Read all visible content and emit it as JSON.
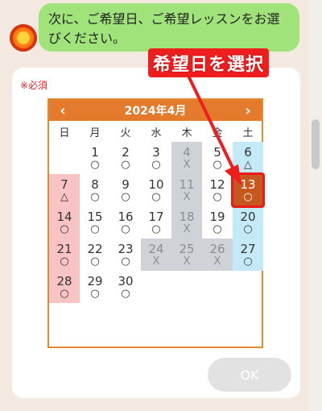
{
  "chat": {
    "message": "次に、ご希望日、ご希望レッスンをお選びください。"
  },
  "form": {
    "required_label": "※必須",
    "ok_label": "OK"
  },
  "calendar": {
    "title": "2024年4月",
    "prev": "‹",
    "next": "›",
    "weekdays": [
      "日",
      "月",
      "火",
      "水",
      "木",
      "金",
      "土"
    ],
    "days": [
      {
        "d": "",
        "m": ""
      },
      {
        "d": "1",
        "m": "○"
      },
      {
        "d": "2",
        "m": "○"
      },
      {
        "d": "3",
        "m": "○"
      },
      {
        "d": "4",
        "m": "X"
      },
      {
        "d": "5",
        "m": "○"
      },
      {
        "d": "6",
        "m": "△"
      },
      {
        "d": "7",
        "m": "△"
      },
      {
        "d": "8",
        "m": "○"
      },
      {
        "d": "9",
        "m": "○"
      },
      {
        "d": "10",
        "m": "○"
      },
      {
        "d": "11",
        "m": "X"
      },
      {
        "d": "12",
        "m": "○"
      },
      {
        "d": "13",
        "m": "○"
      },
      {
        "d": "14",
        "m": "○"
      },
      {
        "d": "15",
        "m": "○"
      },
      {
        "d": "16",
        "m": "○"
      },
      {
        "d": "17",
        "m": "○"
      },
      {
        "d": "18",
        "m": "X"
      },
      {
        "d": "19",
        "m": "○"
      },
      {
        "d": "20",
        "m": "○"
      },
      {
        "d": "21",
        "m": "○"
      },
      {
        "d": "22",
        "m": "○"
      },
      {
        "d": "23",
        "m": "○"
      },
      {
        "d": "24",
        "m": "X"
      },
      {
        "d": "25",
        "m": "X"
      },
      {
        "d": "26",
        "m": "X"
      },
      {
        "d": "27",
        "m": "○"
      },
      {
        "d": "28",
        "m": "○"
      },
      {
        "d": "29",
        "m": "○"
      },
      {
        "d": "30",
        "m": "○"
      },
      {
        "d": "",
        "m": ""
      },
      {
        "d": "",
        "m": ""
      },
      {
        "d": "",
        "m": ""
      },
      {
        "d": "",
        "m": ""
      }
    ],
    "selected_day": "13"
  },
  "annotation": {
    "text": "希望日を選択"
  },
  "colors": {
    "accent": "#e37a2c",
    "bubble": "#9fe37a",
    "annotation": "#ee1e1e"
  }
}
